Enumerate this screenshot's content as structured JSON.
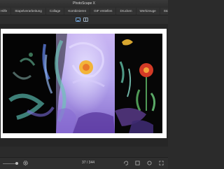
{
  "window": {
    "title": "PhotoScape X"
  },
  "menu": {
    "items": [
      "Hilfe",
      "Stapelverarbeitung",
      "Collage",
      "Kombinieren",
      "GIF erstellen",
      "Drucken",
      "Werkzeuge",
      "Store"
    ]
  },
  "viewbar": {
    "modes": [
      "single-view",
      "split-view"
    ],
    "active": "single-view"
  },
  "photo": {
    "description_icons": "painting"
  },
  "bottombar": {
    "page_counter": "37 / 344"
  },
  "colors": {
    "accent": "#6fa3d8",
    "background": "#2b2b2b",
    "frame": "#ffffff"
  }
}
